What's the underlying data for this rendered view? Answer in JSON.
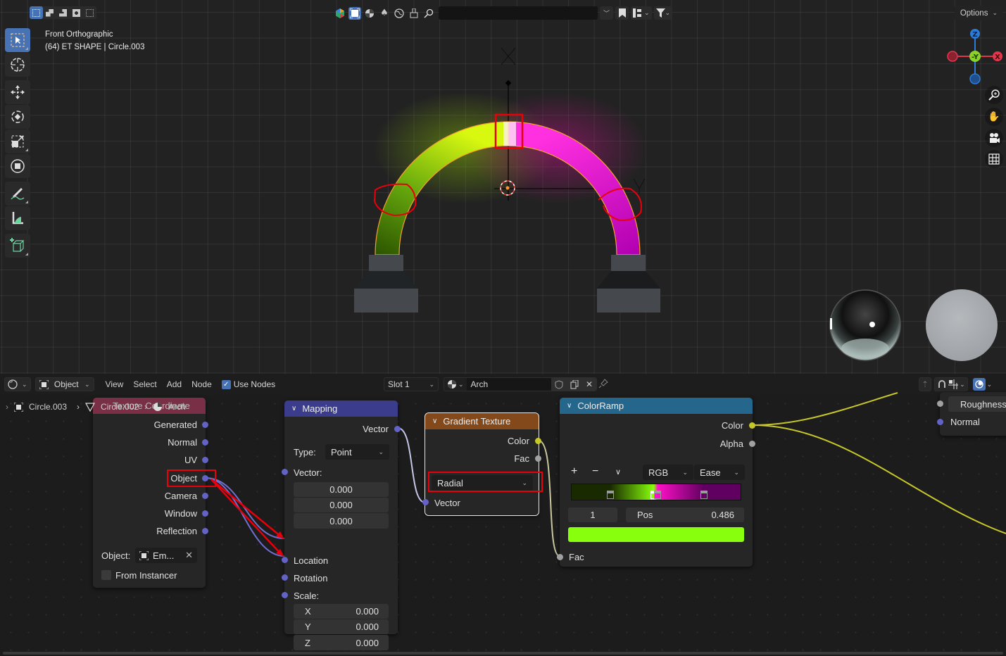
{
  "viewport": {
    "view_name": "Front Orthographic",
    "object_info": "(64) ET SHAPE | Circle.003",
    "options_label": "Options",
    "select_modes": [
      "set",
      "extend",
      "subtract",
      "difference",
      "intersect"
    ],
    "toolbar": [
      {
        "name": "select-box-tool",
        "icon": "cursor-box-icon",
        "active": true
      },
      {
        "name": "cursor-tool",
        "icon": "3d-cursor-icon"
      },
      {
        "name": "move-tool",
        "icon": "move-icon"
      },
      {
        "name": "rotate-tool",
        "icon": "rotate-icon"
      },
      {
        "name": "scale-tool",
        "icon": "scale-icon"
      },
      {
        "name": "transform-tool",
        "icon": "transform-icon"
      },
      {
        "name": "annotate-tool",
        "icon": "annotate-icon"
      },
      {
        "name": "measure-tool",
        "icon": "measure-icon"
      },
      {
        "name": "add-cube-tool",
        "icon": "add-cube-icon"
      }
    ],
    "gizmo": {
      "up": "Z",
      "center": "-Y",
      "right": "X"
    },
    "colors": {
      "green_arch": "#c8f000",
      "magenta_arch": "#ee10d8",
      "x_axis": "#e2374a",
      "y_axis": "#8bd12b",
      "z_axis": "#2c7bd6",
      "annotation_red": "#e8000b"
    }
  },
  "node_editor": {
    "header": {
      "editor_type": "Object",
      "menus": [
        "View",
        "Select",
        "Add",
        "Node"
      ],
      "use_nodes_label": "Use Nodes",
      "use_nodes_checked": true,
      "slot": "Slot 1",
      "material_name": "Arch"
    },
    "breadcrumb": [
      "Circle.003",
      "Circle.002",
      "Arch"
    ],
    "nodes": {
      "texture_coordinate": {
        "title": "Texture Coordinate",
        "outputs": [
          "Generated",
          "Normal",
          "UV",
          "Object",
          "Camera",
          "Window",
          "Reflection"
        ],
        "object_label": "Object:",
        "object_value": "Em...",
        "from_instancer_label": "From Instancer",
        "from_instancer_checked": false,
        "color": "#83314a"
      },
      "mapping": {
        "title": "Mapping",
        "output": "Vector",
        "type_label": "Type:",
        "type_value": "Point",
        "vector_label": "Vector:",
        "vector_values": [
          "0.000",
          "0.000",
          "0.000"
        ],
        "location_label": "Location",
        "rotation_label": "Rotation",
        "scale_label": "Scale:",
        "scale_values": [
          {
            "axis": "X",
            "value": "0.000"
          },
          {
            "axis": "Y",
            "value": "0.000"
          },
          {
            "axis": "Z",
            "value": "0.000"
          }
        ],
        "color": "#3b3c8c"
      },
      "gradient_texture": {
        "title": "Gradient Texture",
        "outputs": [
          "Color",
          "Fac"
        ],
        "gradient_type": "Radial",
        "input": "Vector",
        "color": "#83491b"
      },
      "color_ramp": {
        "title": "ColorRamp",
        "outputs": [
          "Color",
          "Alpha"
        ],
        "add_label": "+",
        "remove_label": "−",
        "color_mode": "RGB",
        "interpolation": "Ease",
        "active_stop_index": "1",
        "pos_label": "Pos",
        "pos_value": "0.486",
        "active_color": "#88ff0c",
        "stops": [
          {
            "pos": 0.23,
            "color": "#1a2a00"
          },
          {
            "pos": 0.486,
            "color": "#88ff0c"
          },
          {
            "pos": 0.51,
            "color": "#ff10c8"
          },
          {
            "pos": 0.78,
            "color": "#600060"
          }
        ],
        "input": "Fac",
        "color": "#24668c"
      },
      "bsdf_partial": {
        "inputs": [
          "Roughness",
          "Normal"
        ]
      }
    }
  }
}
